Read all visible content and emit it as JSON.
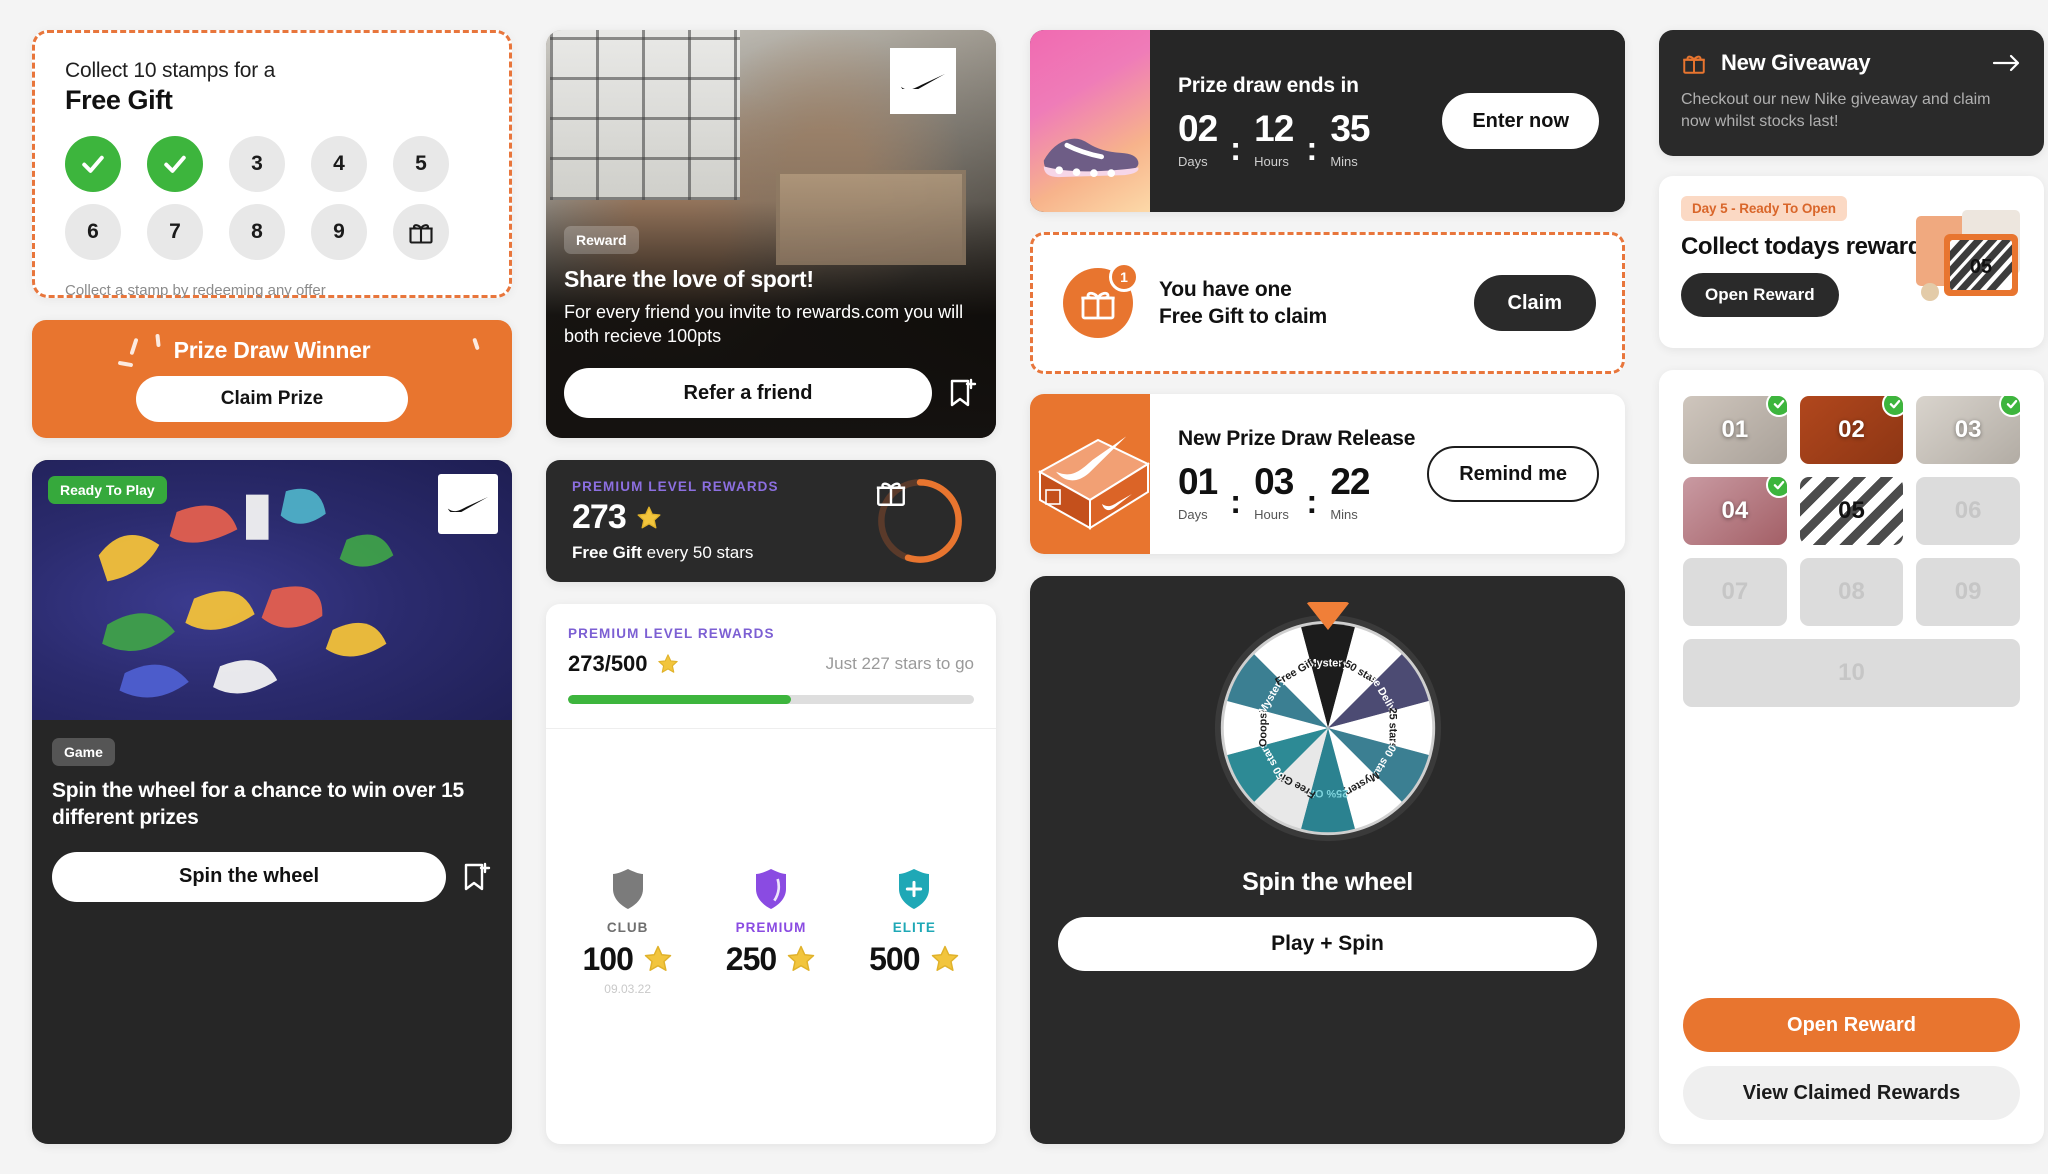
{
  "stamp_card": {
    "lead": "Collect 10 stamps for a",
    "title": "Free Gift",
    "stamps": [
      {
        "label": "1",
        "state": "done"
      },
      {
        "label": "2",
        "state": "done"
      },
      {
        "label": "3",
        "state": "todo"
      },
      {
        "label": "4",
        "state": "todo"
      },
      {
        "label": "5",
        "state": "todo"
      },
      {
        "label": "6",
        "state": "todo"
      },
      {
        "label": "7",
        "state": "todo"
      },
      {
        "label": "8",
        "state": "todo"
      },
      {
        "label": "9",
        "state": "todo"
      },
      {
        "label": "10",
        "state": "gift"
      }
    ],
    "footnote": "Collect a stamp by redeeming any offer",
    "border_color": "#E8763C"
  },
  "prize_winner": {
    "title": "Prize Draw Winner",
    "button": "Claim Prize",
    "bg": "#E8752F"
  },
  "game_card": {
    "status_badge": "Ready To Play",
    "type_badge": "Game",
    "text": "Spin the wheel for a chance to win over 15 different prizes",
    "button": "Spin the wheel",
    "logo": "nike-swoosh-icon",
    "save_icon": "bookmark-add-icon"
  },
  "referral": {
    "badge": "Reward",
    "heading": "Share the love of sport!",
    "body": "For every friend you invite to rewards.com you will both recieve 100pts",
    "button": "Refer a friend",
    "logo": "nike-swoosh-icon",
    "save_icon": "bookmark-add-icon"
  },
  "prize_draw": {
    "heading": "Prize draw ends in",
    "units": [
      {
        "value": "02",
        "label": "Days"
      },
      {
        "value": "12",
        "label": "Hours"
      },
      {
        "value": "35",
        "label": "Mins"
      }
    ],
    "button": "Enter now"
  },
  "free_gift_claim": {
    "badge_count": "1",
    "line1": "You have one",
    "line2": "Free Gift to claim",
    "button": "Claim",
    "icon": "gift-icon"
  },
  "new_release": {
    "heading": "New Prize Draw Release",
    "units": [
      {
        "value": "01",
        "label": "Days"
      },
      {
        "value": "03",
        "label": "Hours"
      },
      {
        "value": "22",
        "label": "Mins"
      }
    ],
    "button": "Remind me"
  },
  "premium_dark": {
    "eyebrow": "PREMIUM LEVEL REWARDS",
    "stars": "273",
    "sub_bold": "Free Gift",
    "sub_rest": " every 50 stars",
    "ring_icon": "gift-icon",
    "ring_percent": 55,
    "accent": "#E8752F",
    "eyebrow_color": "#8C6FE0"
  },
  "premium_light": {
    "eyebrow": "PREMIUM LEVEL REWARDS",
    "fraction": "273/500",
    "to_go": "Just 227 stars to go",
    "progress_percent": 55,
    "progress_color": "#3DB53D",
    "tiers": [
      {
        "name": "CLUB",
        "value": "100",
        "color": "#7B7B7B",
        "date": "09.03.22"
      },
      {
        "name": "PREMIUM",
        "value": "250",
        "color": "#8A4BE2",
        "date": ""
      },
      {
        "name": "ELITE",
        "value": "500",
        "color": "#1FA8B6",
        "date": ""
      }
    ]
  },
  "wheel": {
    "heading": "Spin the wheel",
    "button": "Play + Spin",
    "segments": [
      {
        "label": "Mystery",
        "fill": "#1c1c1c",
        "text": "#ffffff"
      },
      {
        "label": "150 stars",
        "fill": "#ffffff",
        "text": "#1c1c1c"
      },
      {
        "label": "Free Delivery",
        "fill": "#4c4b73",
        "text": "#ffffff"
      },
      {
        "label": "25 stars",
        "fill": "#ffffff",
        "text": "#1c1c1c"
      },
      {
        "label": "100 stars",
        "fill": "#3b7f92",
        "text": "#ffffff"
      },
      {
        "label": "Mystery",
        "fill": "#ffffff",
        "text": "#1c1c1c"
      },
      {
        "label": "25% Off",
        "fill": "#2b8290",
        "text": "#7fd4dd"
      },
      {
        "label": "Free Gift",
        "fill": "#e8e8e8",
        "text": "#1c1c1c"
      },
      {
        "label": "50 stars",
        "fill": "#2d8a95",
        "text": "#ffffff"
      },
      {
        "label": "Ooops!",
        "fill": "#ffffff",
        "text": "#1c1c1c"
      },
      {
        "label": "Mystery",
        "fill": "#3b7f92",
        "text": "#ffffff"
      },
      {
        "label": "Free Gift",
        "fill": "#ffffff",
        "text": "#1c1c1c"
      }
    ],
    "pointer_color": "#F07F38"
  },
  "giveaway": {
    "title": "New Giveaway",
    "body": "Checkout our new Nike giveaway and claim now whilst stocks last!",
    "icon": "gift-icon",
    "arrow_icon": "arrow-right-icon"
  },
  "today_reward": {
    "chip": "Day 5 - Ready To Open",
    "heading": "Collect todays reward",
    "button": "Open Reward",
    "art_number": "05"
  },
  "rewards_grid": {
    "items": [
      {
        "label": "01",
        "state": "claimed"
      },
      {
        "label": "02",
        "state": "claimed"
      },
      {
        "label": "03",
        "state": "claimed"
      },
      {
        "label": "04",
        "state": "claimed"
      },
      {
        "label": "05",
        "state": "today"
      },
      {
        "label": "06",
        "state": "locked"
      },
      {
        "label": "07",
        "state": "locked"
      },
      {
        "label": "08",
        "state": "locked"
      },
      {
        "label": "09",
        "state": "locked"
      },
      {
        "label": "10",
        "state": "locked-wide"
      }
    ],
    "open_button": "Open Reward",
    "view_button": "View Claimed Rewards",
    "open_color": "#E8752F"
  }
}
